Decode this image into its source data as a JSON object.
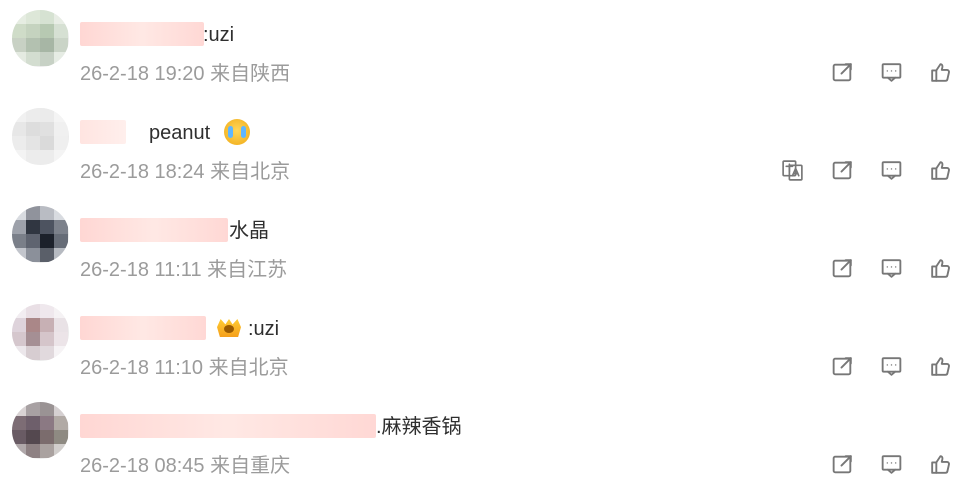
{
  "comments": [
    {
      "text": ":uzi",
      "meta": "26-2-18 19:20 来自陕西",
      "actions": {
        "share": "share-icon",
        "reply": "comment-icon",
        "like": "thumb-up-icon"
      }
    },
    {
      "text": "peanut",
      "meta": "26-2-18 18:24 来自北京",
      "emoji": "crying-emoji",
      "actions": {
        "translate": "translate-icon",
        "share": "share-icon",
        "reply": "comment-icon",
        "like": "thumb-up-icon"
      }
    },
    {
      "text": "水晶",
      "meta": "26-2-18 11:11 来自江苏",
      "actions": {
        "share": "share-icon",
        "reply": "comment-icon",
        "like": "thumb-up-icon"
      }
    },
    {
      "text": ":uzi",
      "meta": "26-2-18 11:10 来自北京",
      "badge": "crown-badge",
      "actions": {
        "share": "share-icon",
        "reply": "comment-icon",
        "like": "thumb-up-icon"
      }
    },
    {
      "text": ".麻辣香锅",
      "meta": "26-2-18 08:45 来自重庆",
      "actions": {
        "share": "share-icon",
        "reply": "comment-icon",
        "like": "thumb-up-icon"
      }
    }
  ],
  "colors": {
    "text": "#2f2f2f",
    "meta": "#9b9b9b",
    "icon": "#777777",
    "blur_pink": "#ffc1bb"
  }
}
